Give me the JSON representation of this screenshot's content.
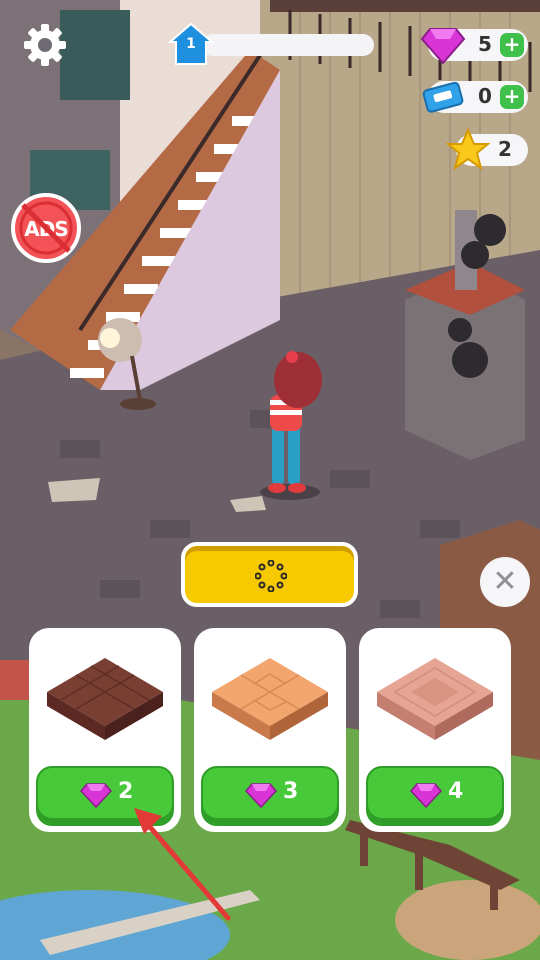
{
  "hud": {
    "level": "1",
    "gems": "5",
    "tickets": "0",
    "stars": "2",
    "no_ads_label": "ADS"
  },
  "floor_options": [
    {
      "price": "2",
      "style": "dark-walnut-basketweave"
    },
    {
      "price": "3",
      "style": "light-oak-herringbone"
    },
    {
      "price": "4",
      "style": "pink-patterned-tile"
    }
  ],
  "colors": {
    "gem": "#d935d6",
    "buy_button": "#48c93a",
    "confirm_button": "#f6c900",
    "plus_button": "#3fc04a"
  }
}
